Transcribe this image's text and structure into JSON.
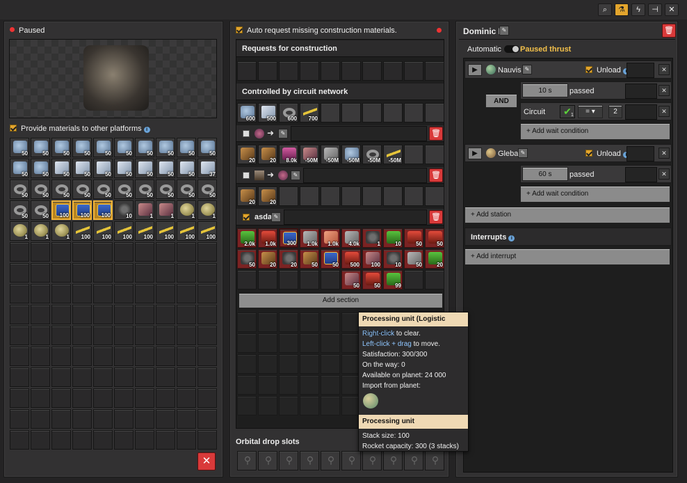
{
  "toolbar": {
    "icons": [
      "search-icon",
      "network-icon",
      "lightning-icon",
      "pin-icon",
      "close-icon"
    ]
  },
  "left": {
    "status": "Paused",
    "provide_label": "Provide materials to other platforms",
    "inventory": [
      {
        "t": "ore",
        "n": "50"
      },
      {
        "t": "ore",
        "n": "50"
      },
      {
        "t": "ore",
        "n": "50"
      },
      {
        "t": "ore",
        "n": "50"
      },
      {
        "t": "ore",
        "n": "50"
      },
      {
        "t": "ore",
        "n": "50"
      },
      {
        "t": "ore",
        "n": "50"
      },
      {
        "t": "ore",
        "n": "50"
      },
      {
        "t": "ore",
        "n": "50"
      },
      {
        "t": "ore",
        "n": "50"
      },
      {
        "t": "ore",
        "n": "50"
      },
      {
        "t": "ore",
        "n": "50"
      },
      {
        "t": "cube",
        "n": "50"
      },
      {
        "t": "cube",
        "n": "50"
      },
      {
        "t": "cube",
        "n": "50"
      },
      {
        "t": "cube",
        "n": "50"
      },
      {
        "t": "cube",
        "n": "50"
      },
      {
        "t": "cube",
        "n": "50"
      },
      {
        "t": "cube",
        "n": "50"
      },
      {
        "t": "cube",
        "n": "37"
      },
      {
        "t": "ring",
        "n": "50"
      },
      {
        "t": "ring",
        "n": "50"
      },
      {
        "t": "ring",
        "n": "50"
      },
      {
        "t": "ring",
        "n": "50"
      },
      {
        "t": "ring",
        "n": "50"
      },
      {
        "t": "ring",
        "n": "50"
      },
      {
        "t": "ring",
        "n": "50"
      },
      {
        "t": "ring",
        "n": "50"
      },
      {
        "t": "ring",
        "n": "50"
      },
      {
        "t": "ring",
        "n": "50"
      },
      {
        "t": "ring",
        "n": "50"
      },
      {
        "t": "ring",
        "n": "50"
      },
      {
        "t": "chip",
        "n": "100",
        "s": 1
      },
      {
        "t": "chip",
        "n": "100",
        "s": 1
      },
      {
        "t": "chip",
        "n": "100",
        "s": 1
      },
      {
        "t": "gear",
        "n": "10"
      },
      {
        "t": "crate",
        "n": "1"
      },
      {
        "t": "crate",
        "n": "1"
      },
      {
        "t": "shell",
        "n": "1"
      },
      {
        "t": "shell",
        "n": "1"
      },
      {
        "t": "shell",
        "n": "1"
      },
      {
        "t": "shell",
        "n": "1"
      },
      {
        "t": "shell",
        "n": "1"
      },
      {
        "t": "belt",
        "n": "100"
      },
      {
        "t": "belt",
        "n": "100"
      },
      {
        "t": "belt",
        "n": "100"
      },
      {
        "t": "belt",
        "n": "100"
      },
      {
        "t": "belt",
        "n": "100"
      },
      {
        "t": "belt",
        "n": "100"
      },
      {
        "t": "belt",
        "n": "100"
      }
    ]
  },
  "mid": {
    "auto_label": "Auto request missing construction materials.",
    "requests_title": "Requests for construction",
    "circuit_title": "Controlled by circuit network",
    "circuit_items": [
      {
        "t": "ore",
        "n": "600"
      },
      {
        "t": "cube",
        "n": "500"
      },
      {
        "t": "ring",
        "n": "600"
      },
      {
        "t": "belt",
        "n": "700"
      }
    ],
    "sec1_items": [
      {
        "t": "arm",
        "n": "20"
      },
      {
        "t": "arm",
        "n": "20"
      },
      {
        "t": "pink",
        "n": "8.0k"
      },
      {
        "t": "crate",
        "n": "-50M"
      },
      {
        "t": "stone",
        "n": "-50M"
      },
      {
        "t": "ore",
        "n": "-50M"
      },
      {
        "t": "ring",
        "n": "-50M"
      },
      {
        "t": "belt",
        "n": "-50M"
      }
    ],
    "sec2_items": [
      {
        "t": "arm",
        "n": "20"
      },
      {
        "t": "arm",
        "n": "20"
      }
    ],
    "asda_name": "asda",
    "asda_items": [
      {
        "t": "green",
        "n": "2.0k"
      },
      {
        "t": "red",
        "n": "1.0k"
      },
      {
        "t": "chip",
        "n": "300",
        "s": 1
      },
      {
        "t": "stone",
        "n": "1.0k"
      },
      {
        "t": "plate",
        "n": "1.0k"
      },
      {
        "t": "stone",
        "n": "4.0k"
      },
      {
        "t": "gear",
        "n": "1"
      },
      {
        "t": "green",
        "n": "10"
      },
      {
        "t": "red",
        "n": "50"
      },
      {
        "t": "red",
        "n": "50"
      },
      {
        "t": "gear",
        "n": "50"
      },
      {
        "t": "arm",
        "n": "20"
      },
      {
        "t": "gear",
        "n": "20"
      },
      {
        "t": "arm",
        "n": "50"
      },
      {
        "t": "chip",
        "n": "50"
      },
      {
        "t": "red",
        "n": "500"
      },
      {
        "t": "crate",
        "n": "100"
      },
      {
        "t": "gear",
        "n": "10"
      },
      {
        "t": "stone",
        "n": "50"
      },
      {
        "t": "green",
        "n": "20"
      },
      {
        "t": "",
        "n": ""
      },
      {
        "t": "",
        "n": ""
      },
      {
        "t": "",
        "n": ""
      },
      {
        "t": "",
        "n": ""
      },
      {
        "t": "",
        "n": ""
      },
      {
        "t": "crate",
        "n": "50"
      },
      {
        "t": "red",
        "n": "50"
      },
      {
        "t": "green",
        "n": "99"
      },
      {
        "t": "",
        "n": ""
      },
      {
        "t": "",
        "n": ""
      }
    ],
    "add_section": "Add section",
    "orbital_title": "Orbital drop slots"
  },
  "tooltip": {
    "title": "Processing unit (Logistic request)",
    "l1a": "Right-click",
    "l1b": " to clear.",
    "l2a": "Left-click + drag",
    "l2b": " to move.",
    "sat": "Satisfaction: 300/300",
    "way": "On the way: 0",
    "avail": "Available on planet: 24 000",
    "import": "Import from planet:",
    "title2": "Processing unit",
    "stack": "Stack size: 100",
    "rocket": "Rocket capacity: 300 (3 stacks)"
  },
  "right": {
    "name": "Dominic B",
    "automatic": "Automatic",
    "paused": "Paused thrust",
    "st1": "Nauvis",
    "unload": "Unload",
    "and": "AND",
    "cond1_val": "10 s",
    "passed": "passed",
    "circuit": "Circuit",
    "circuit_n": "1",
    "cmp": "=",
    "cmp_val": "2",
    "add_wait": "+ Add wait condition",
    "st2": "Gleba",
    "cond2_val": "60 s",
    "add_station": "+ Add station",
    "interrupts": "Interrupts",
    "add_interrupt": "+ Add interrupt"
  }
}
